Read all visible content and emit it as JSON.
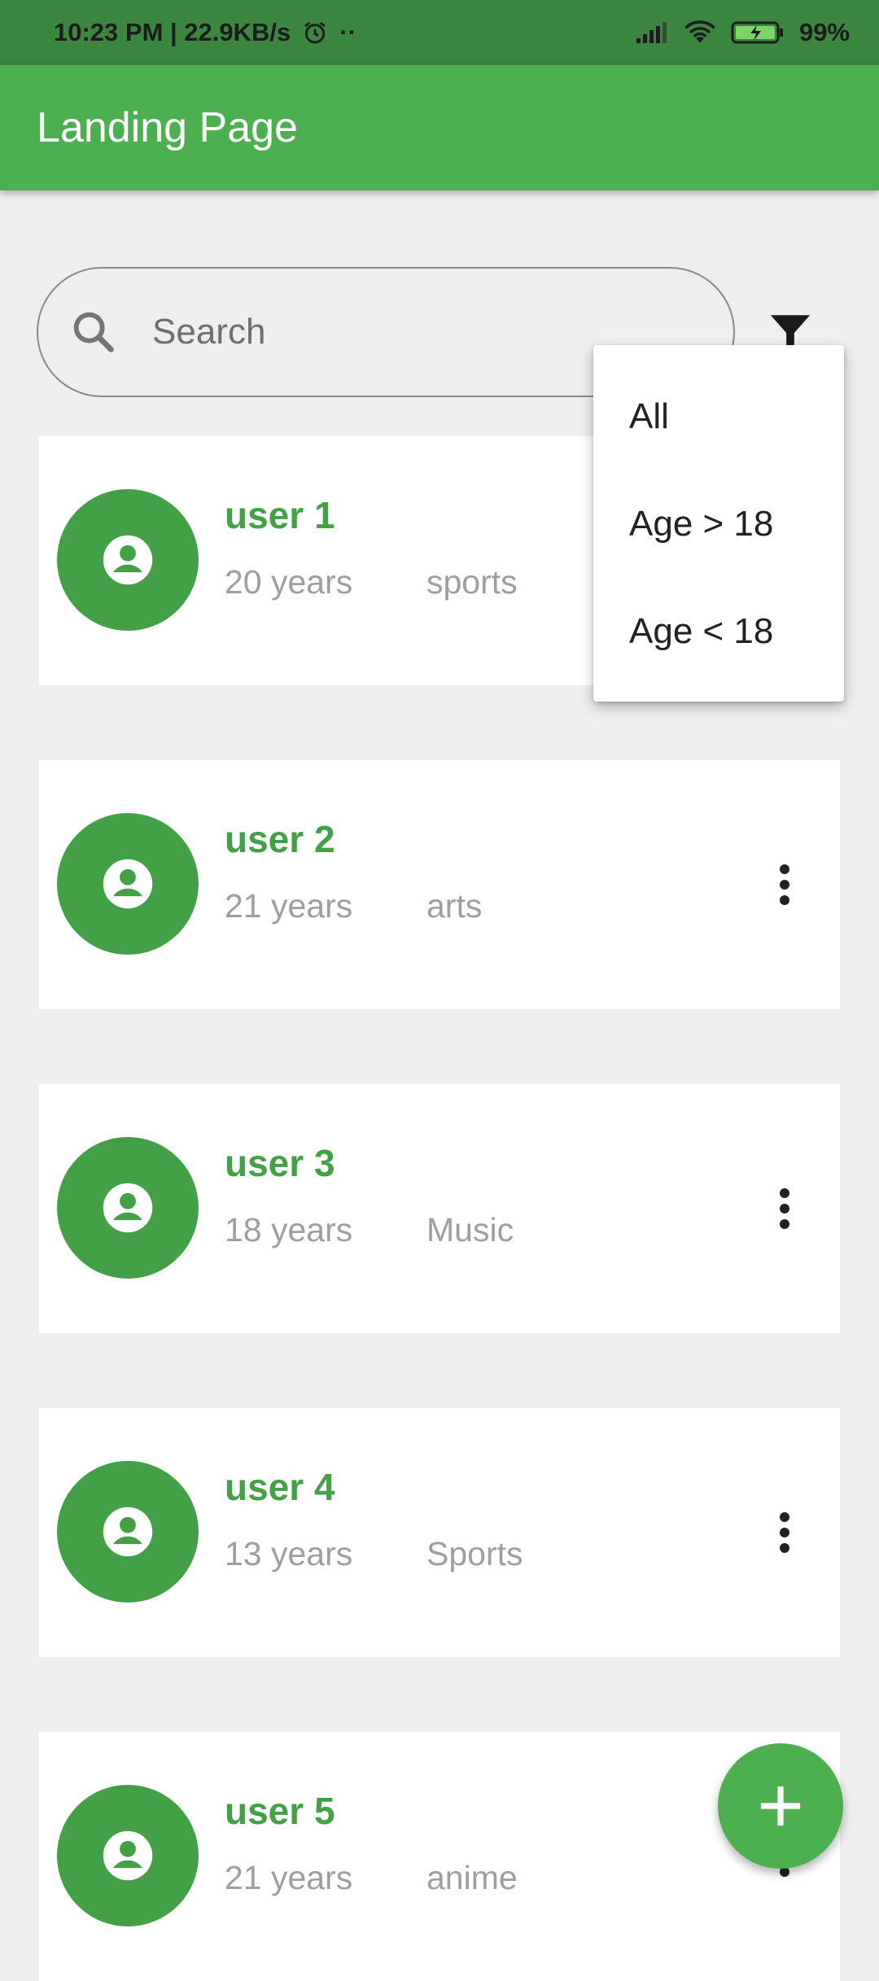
{
  "status_bar": {
    "time_speed": "10:23 PM | 22.9KB/s",
    "extra": "··",
    "battery": "99%"
  },
  "app_bar": {
    "title": "Landing Page"
  },
  "search": {
    "placeholder": "Search"
  },
  "filter_menu": {
    "items": [
      {
        "label": "All"
      },
      {
        "label": "Age > 18"
      },
      {
        "label": "Age < 18"
      }
    ]
  },
  "users": [
    {
      "name": "user 1",
      "age": "20 years",
      "interest": "sports"
    },
    {
      "name": "user 2",
      "age": "21 years",
      "interest": "arts"
    },
    {
      "name": "user 3",
      "age": "18 years",
      "interest": "Music"
    },
    {
      "name": "user 4",
      "age": "13 years",
      "interest": "Sports"
    },
    {
      "name": "user 5",
      "age": "21 years",
      "interest": "anime"
    }
  ],
  "colors": {
    "primary": "#4caf50",
    "primary_dark": "#3b873f",
    "avatar": "#43a047"
  },
  "icons": {
    "search": "search-icon",
    "filter": "filter-icon",
    "avatar": "account-circle-icon",
    "more": "more-vert-icon",
    "add": "plus-icon"
  }
}
